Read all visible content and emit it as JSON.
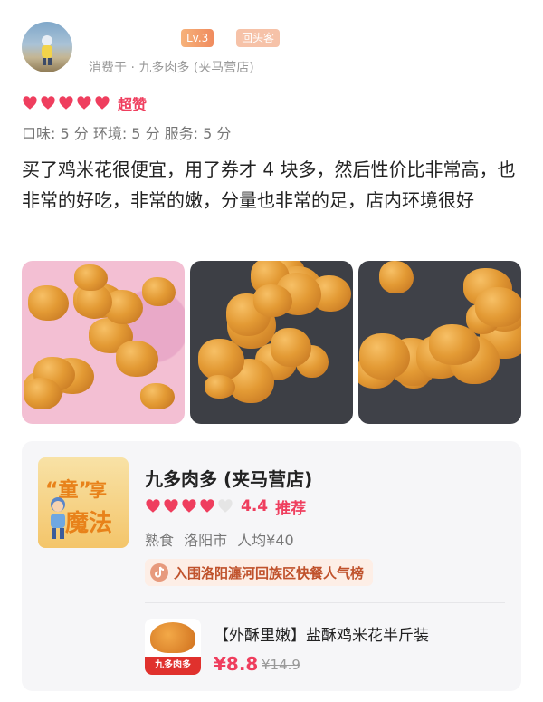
{
  "user": {
    "level_badge": "Lv.3",
    "returning_badge": "回头客",
    "consumed_at": "消费于 · 九多肉多 (夹马营店)"
  },
  "rating": {
    "hearts_filled": 5,
    "hearts_total": 5,
    "label": "超赞"
  },
  "scores": "口味: 5 分  环境: 5 分  服务: 5 分",
  "review_text": "买了鸡米花很便宜，用了券才 4 块多，然后性价比非常高，也非常的好吃，非常的嫩，分量也非常的足，店内环境很好",
  "photos": [
    {
      "name": "photo-1"
    },
    {
      "name": "photo-2"
    },
    {
      "name": "photo-3"
    }
  ],
  "shop": {
    "thumb_text_1": "“童”",
    "thumb_text_2": "享",
    "thumb_text_3": "魔法",
    "name": "九多肉多 (夹马营店)",
    "hearts_filled": 4,
    "hearts_total": 5,
    "score": "4.4",
    "recommend": "推荐",
    "meta": "熟食 洛阳市 人均¥40",
    "rank": "入围洛阳瀍河回族区快餐人气榜"
  },
  "deal": {
    "thumb_band": "九多肉多",
    "title": "【外酥里嫩】盐酥鸡米花半斤装",
    "price": "¥8.8",
    "original_price": "¥14.9"
  },
  "colors": {
    "accent": "#ef3e5e",
    "heart": "#ef3e5e",
    "heart_empty": "#e5e5e5",
    "card_bg": "#f6f6f8"
  }
}
